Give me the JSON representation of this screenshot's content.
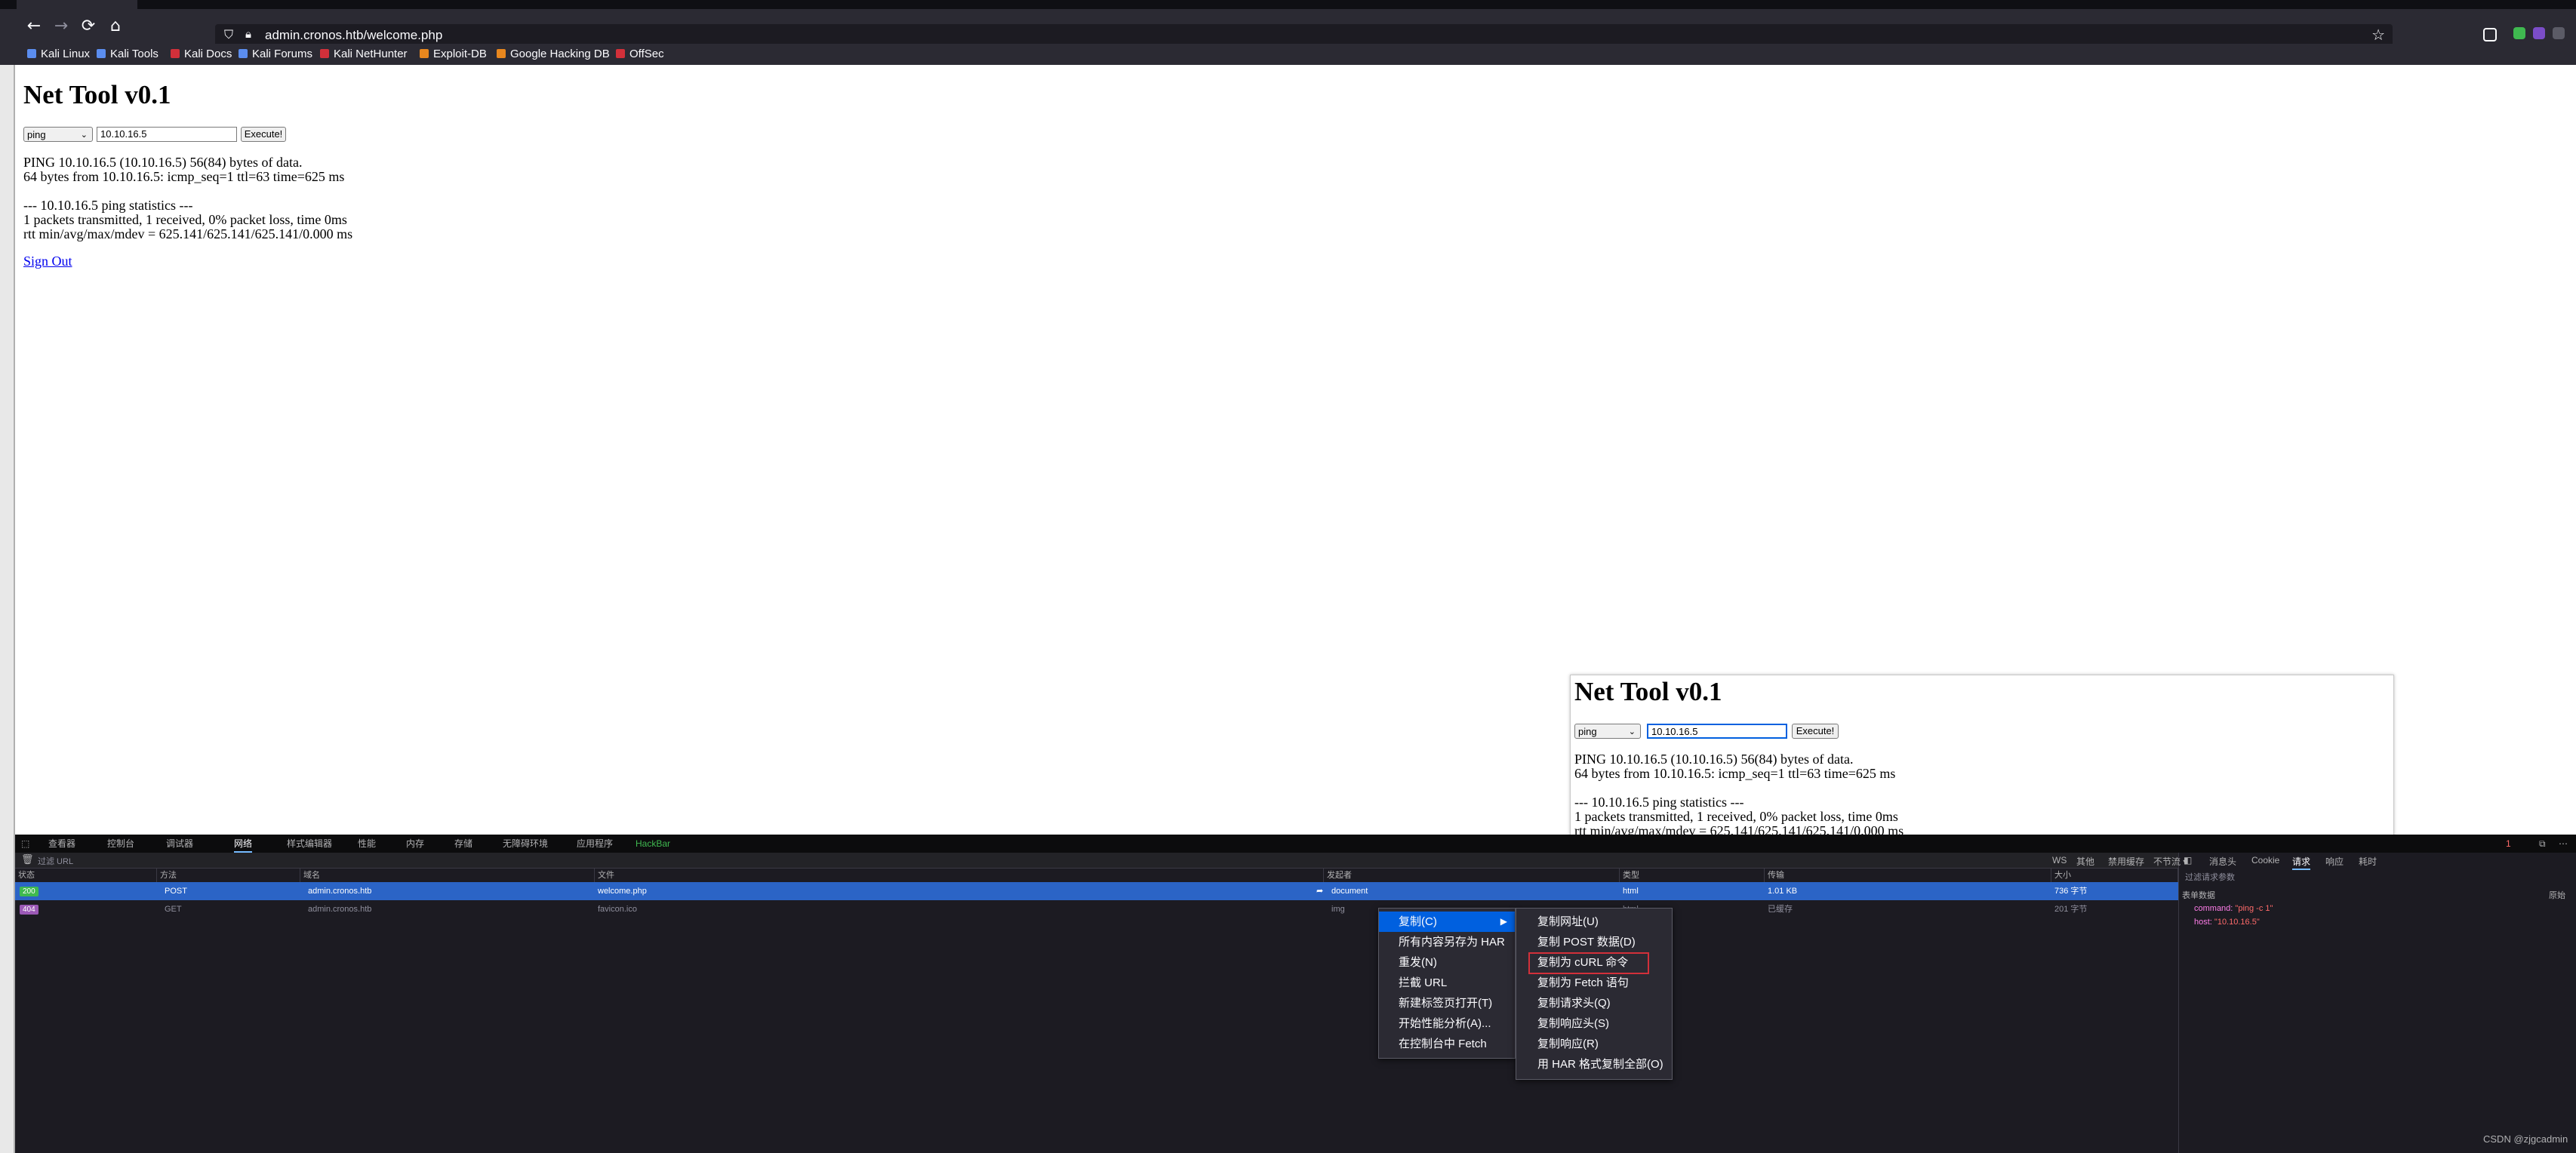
{
  "browser": {
    "url": "admin.cronos.htb/welcome.php",
    "bookmarks": [
      "Kali Linux",
      "Kali Tools",
      "Kali Docs",
      "Kali Forums",
      "Kali NetHunter",
      "Exploit-DB",
      "Google Hacking DB",
      "OffSec"
    ]
  },
  "page": {
    "title": "Net Tool v0.1",
    "command_value": "ping",
    "host_value": "10.10.16.5",
    "execute_label": "Execute!",
    "output": "PING 10.10.16.5 (10.10.16.5) 56(84) bytes of data.\n64 bytes from 10.10.16.5: icmp_seq=1 ttl=63 time=625 ms\n\n--- 10.10.16.5 ping statistics ---\n1 packets transmitted, 1 received, 0% packet loss, time 0ms\nrtt min/avg/max/mdev = 625.141/625.141/625.141/0.000 ms",
    "signout": "Sign Out"
  },
  "devtools": {
    "tabs": [
      "查看器",
      "控制台",
      "调试器",
      "网络",
      "样式编辑器",
      "性能",
      "内存",
      "存储",
      "无障碍环境",
      "应用程序",
      "HackBar"
    ],
    "active_tab": "网络",
    "filter_placeholder": "过滤 URL",
    "columns": [
      "状态",
      "方法",
      "域名",
      "文件",
      "发起者",
      "类型",
      "传输",
      "大小"
    ],
    "requests": [
      {
        "status": "200",
        "method": "POST",
        "domain": "admin.cronos.htb",
        "file": "welcome.php",
        "initiator": "document",
        "type": "html",
        "transferred": "1.01 KB",
        "size": "736 字节"
      },
      {
        "status": "404",
        "method": "GET",
        "domain": "admin.cronos.htb",
        "file": "favicon.ico",
        "initiator": "img",
        "type": "html",
        "transferred": "已缓存",
        "size": "201 字节"
      }
    ],
    "side_tabs": [
      "消息头",
      "Cookie",
      "请求",
      "响应",
      "耗时"
    ],
    "side_active": "请求",
    "side_filter_placeholder": "过滤请求参数",
    "form_data_label": "表单数据",
    "raw_label": "原始",
    "form_fields": [
      {
        "key": "command:",
        "value": "\"ping -c 1\""
      },
      {
        "key": "host:",
        "value": "\"10.10.16.5\""
      }
    ],
    "right_tools": [
      "WS",
      "其他",
      "禁用缓存",
      "不节流 ▾"
    ],
    "error_count": "1"
  },
  "context_menu": {
    "items": [
      "复制(C)",
      "所有内容另存为 HAR",
      "重发(N)",
      "拦截 URL",
      "新建标签页打开(T)",
      "开始性能分析(A)...",
      "在控制台中 Fetch"
    ],
    "submenu": [
      "复制网址(U)",
      "复制 POST 数据(D)",
      "复制为 cURL 命令",
      "复制为 Fetch 语句",
      "复制请求头(Q)",
      "复制响应头(S)",
      "复制响应(R)",
      "用 HAR 格式复制全部(O)"
    ]
  },
  "watermark": "CSDN @zjgcadmin",
  "colors": {
    "accent": "#0060df",
    "status_ok": "#3fb950",
    "status_404": "#9b59b6",
    "highlight_row": "#2b64c6",
    "annotation_red": "#d2303a"
  }
}
